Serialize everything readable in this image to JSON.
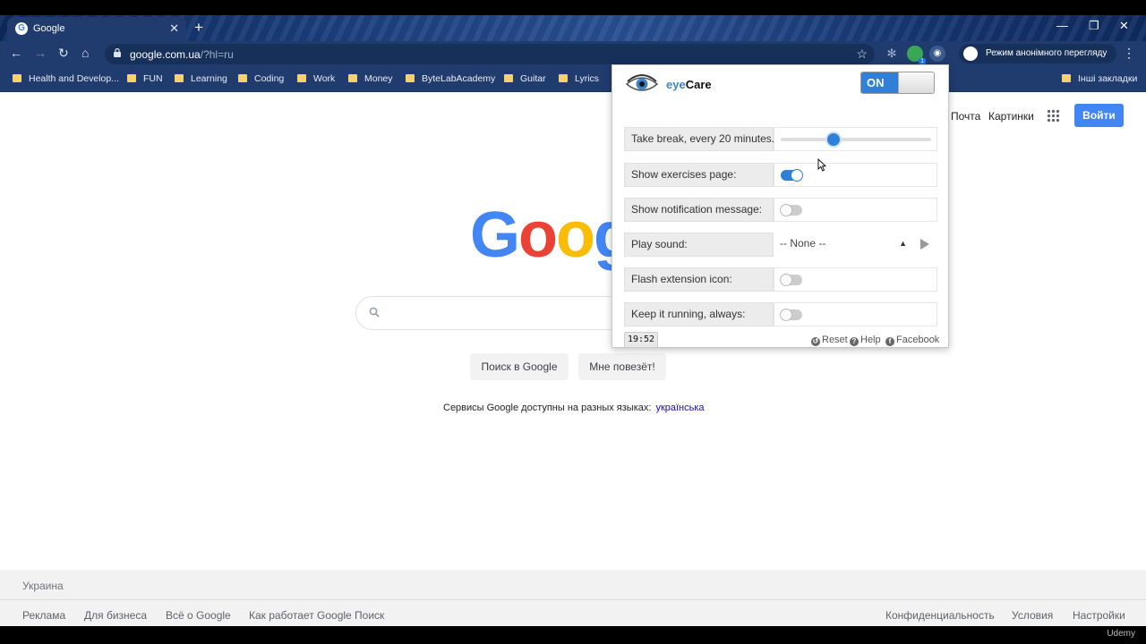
{
  "browser": {
    "tab_title": "Google",
    "tab_close": "✕",
    "new_tab": "+",
    "url_host": "google.com.ua",
    "url_path": "/?hl=ru",
    "incognito_label": "Режим анонімного перегляду",
    "extension_badge": "1"
  },
  "bookmarks": [
    {
      "label": "Health and Develop..."
    },
    {
      "label": "FUN"
    },
    {
      "label": "Learning"
    },
    {
      "label": "Coding"
    },
    {
      "label": "Work"
    },
    {
      "label": "Money"
    },
    {
      "label": "ByteLabAcademy"
    },
    {
      "label": "Guitar"
    },
    {
      "label": "Lyrics"
    }
  ],
  "other_bookmarks": "Інші закладки",
  "google": {
    "mail": "Почта",
    "images": "Картинки",
    "signin": "Войти",
    "logo": [
      "G",
      "o",
      "o",
      "g"
    ],
    "search_button": "Поиск в Google",
    "lucky_button": "Мне повезёт!",
    "langs_text": "Сервисы Google доступны на разных языках:",
    "langs_link": "українська",
    "footer_country": "Украина",
    "footer_left": [
      "Реклама",
      "Для бизнеса",
      "Всё о Google",
      "Как работает Google Поиск"
    ],
    "footer_right": [
      "Конфиденциальность",
      "Условия",
      "Настройки"
    ]
  },
  "eyecare": {
    "title_eye": "eye",
    "title_care": "Care",
    "power_label": "ON",
    "rows": {
      "break": {
        "label": "Take break, every 20 minutes.",
        "slider_fraction": 0.35
      },
      "exercises": {
        "label": "Show exercises page:",
        "on": true
      },
      "notification": {
        "label": "Show notification message:",
        "on": false
      },
      "sound": {
        "label": "Play sound:",
        "value": "-- None --"
      },
      "flash": {
        "label": "Flash extension icon:",
        "on": false
      },
      "keep": {
        "label": "Keep it running, always:",
        "on": false
      }
    },
    "clock": "19:52",
    "links": {
      "reset": "Reset",
      "help": "Help",
      "facebook": "Facebook"
    }
  },
  "watermark": "Udemy"
}
